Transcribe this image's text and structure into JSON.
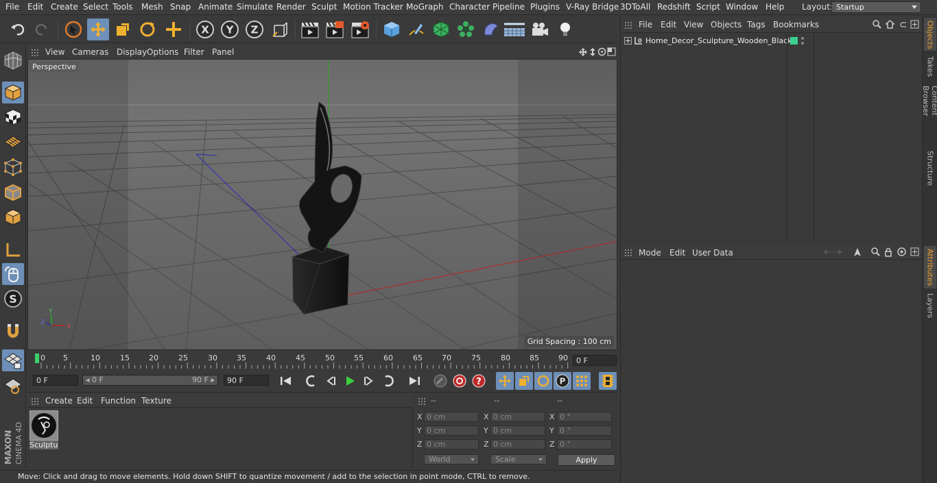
{
  "menubar": {
    "items": [
      "File",
      "Edit",
      "Create",
      "Select",
      "Tools",
      "Mesh",
      "Snap",
      "Animate",
      "Simulate",
      "Render",
      "Sculpt",
      "Motion Tracker",
      "MoGraph",
      "Character",
      "Pipeline",
      "Plugins",
      "V-Ray Bridge",
      "3DToAll",
      "Redshift",
      "Script",
      "Window",
      "Help"
    ],
    "layout_label": "Layout:",
    "layout_value": "Startup"
  },
  "viewport": {
    "menu": [
      "View",
      "Cameras",
      "Display",
      "Options",
      "Filter",
      "Panel"
    ],
    "camera_label": "Perspective",
    "grid_spacing": "Grid Spacing : 100 cm",
    "axis_labels": {
      "x": "X",
      "y": "Y",
      "z": "Z"
    }
  },
  "timeline": {
    "ticks": [
      "0",
      "5",
      "10",
      "15",
      "20",
      "25",
      "30",
      "35",
      "40",
      "45",
      "50",
      "55",
      "60",
      "65",
      "70",
      "75",
      "80",
      "85",
      "90"
    ],
    "current_frame": "0 F",
    "start_frame": "0 F",
    "range_start": "0 F",
    "range_end": "90 F",
    "end_frame": "90 F"
  },
  "materials": {
    "menu": [
      "Create",
      "Edit",
      "Function",
      "Texture"
    ],
    "items": [
      {
        "name": "Sculptur"
      }
    ]
  },
  "coordinates": {
    "headers": [
      "--",
      "--",
      "--"
    ],
    "rows": [
      {
        "axis": "X",
        "pos": "0 cm",
        "size_axis": "X",
        "size": "0 cm",
        "rot_axis": "X",
        "rot": "0 °"
      },
      {
        "axis": "Y",
        "pos": "0 cm",
        "size_axis": "Y",
        "size": "0 cm",
        "rot_axis": "Y",
        "rot": "0 °"
      },
      {
        "axis": "Z",
        "pos": "0 cm",
        "size_axis": "Z",
        "size": "0 cm",
        "rot_axis": "Z",
        "rot": "0 °"
      }
    ],
    "space_dropdown": "World",
    "mode_dropdown": "Scale",
    "apply_label": "Apply"
  },
  "status": {
    "text": "Move: Click and drag to move elements. Hold down SHIFT to quantize movement / add to the selection in point mode, CTRL to remove."
  },
  "objects": {
    "menu": [
      "File",
      "Edit",
      "View",
      "Objects",
      "Tags",
      "Bookmarks"
    ],
    "items": [
      {
        "name": "Home_Decor_Sculpture_Wooden_Black",
        "tag_color": "#3ccf8e"
      }
    ]
  },
  "attributes": {
    "menu": [
      "Mode",
      "Edit",
      "User Data"
    ]
  },
  "side_tabs": [
    "Objects",
    "Takes",
    "Content Browser",
    "Structure",
    "Attributes",
    "Layers"
  ],
  "brand": {
    "maxon": "MAXON",
    "product": "CINEMA 4D"
  },
  "colors": {
    "accent": "#6d8fb8",
    "timeline_marker": "#3ccf6a",
    "play_green": "#3ccf3c",
    "active_tab": "#f0a030"
  }
}
